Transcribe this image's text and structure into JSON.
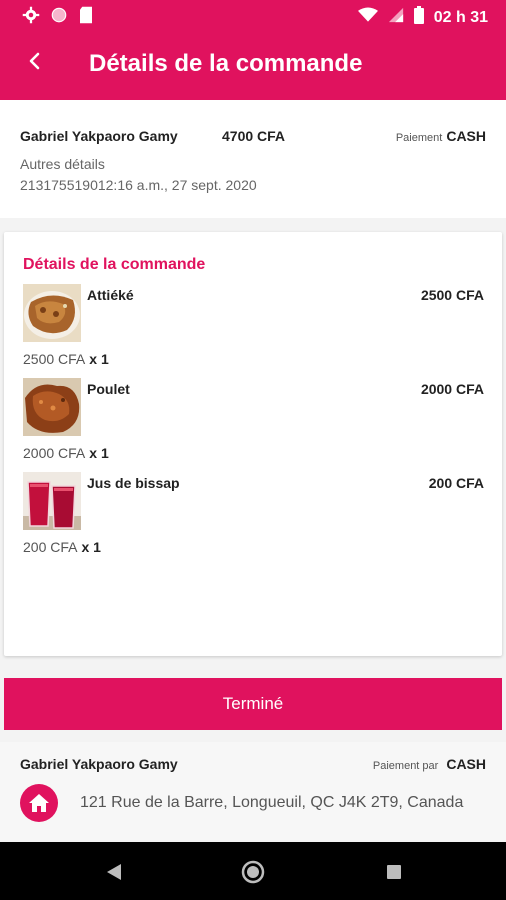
{
  "status_bar": {
    "time": "02 h 31"
  },
  "header": {
    "title": "Détails de la commande"
  },
  "order": {
    "customer_name": "Gabriel Yakpaoro Gamy",
    "total": "4700 CFA",
    "payment_label": "Paiement",
    "payment_value": "CASH",
    "other_details_label": "Autres détails",
    "id_and_date": "213175519012:16 a.m., 27 sept. 2020"
  },
  "items_section": {
    "title": "Détails de la commande",
    "items": [
      {
        "name": "Attiéké",
        "price": "2500 CFA",
        "unit_price": "2500 CFA",
        "qty": "x 1"
      },
      {
        "name": "Poulet",
        "price": "2000 CFA",
        "unit_price": "2000 CFA",
        "qty": "x 1"
      },
      {
        "name": "Jus de bissap",
        "price": "200 CFA",
        "unit_price": "200 CFA",
        "qty": "x 1"
      }
    ]
  },
  "done_button": {
    "label": "Terminé"
  },
  "delivery": {
    "name": "Gabriel Yakpaoro Gamy",
    "payment_label": "Paiement par",
    "payment_value": "CASH",
    "address": "121 Rue de la Barre, Longueuil, QC J4K 2T9, Canada"
  },
  "colors": {
    "accent": "#e0125e"
  },
  "icons": [
    "gear-icon",
    "circle-icon",
    "sd-card-icon",
    "wifi-icon",
    "signal-icon",
    "battery-icon",
    "back-arrow-icon",
    "home-icon",
    "nav-back-icon",
    "nav-home-icon",
    "nav-recents-icon"
  ]
}
